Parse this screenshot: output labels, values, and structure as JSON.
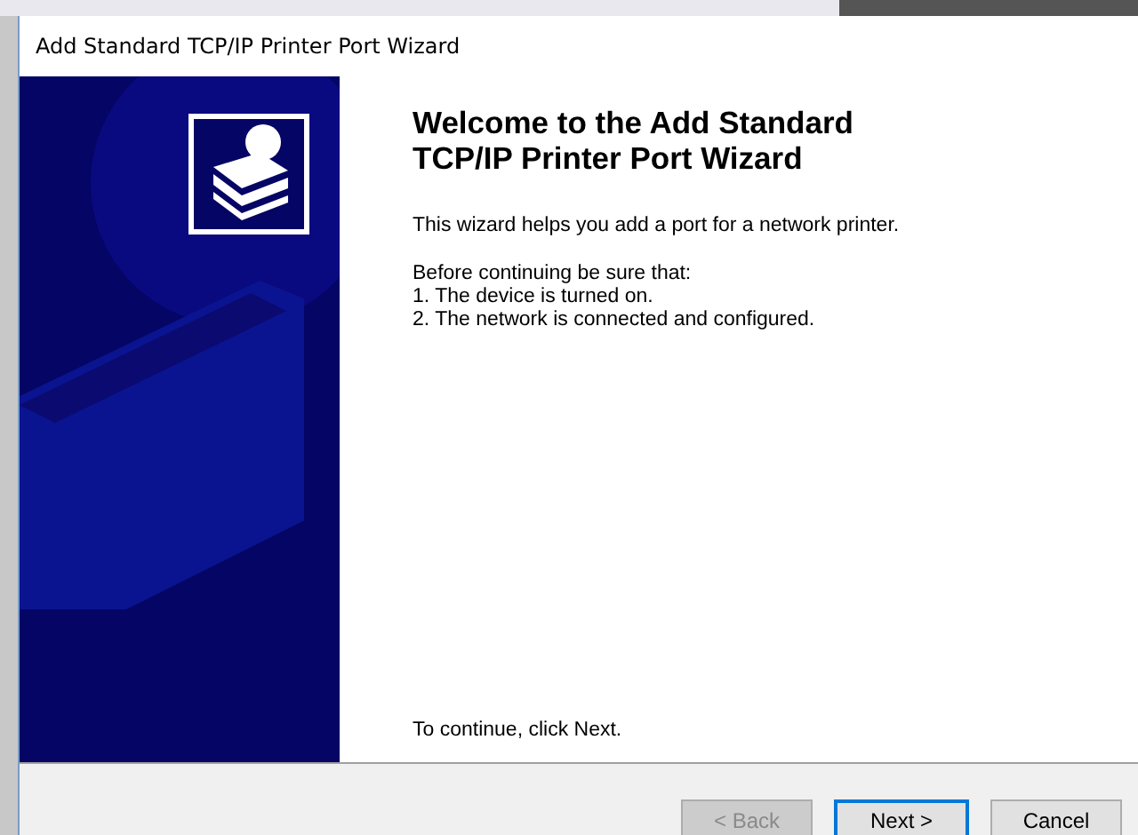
{
  "window": {
    "title": "Add Standard TCP/IP Printer Port Wizard"
  },
  "heading": "Welcome to the Add Standard TCP/IP Printer Port Wizard",
  "intro": "This wizard helps you add a port for a network printer.",
  "checklist_title": "Before continuing be sure that:",
  "checklist": [
    {
      "number": "1.",
      "text": "The device is turned on."
    },
    {
      "number": "2.",
      "text": "The network is connected and configured."
    }
  ],
  "footer_hint": "To continue, click Next.",
  "buttons": [
    {
      "label": "< Back",
      "disabled": true,
      "default": false
    },
    {
      "label": "Next >",
      "disabled": false,
      "default": true
    },
    {
      "label": "Cancel",
      "disabled": false,
      "default": false
    }
  ]
}
